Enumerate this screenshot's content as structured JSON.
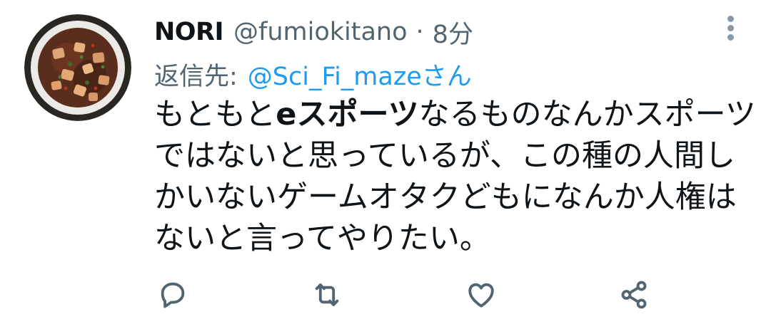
{
  "tweet": {
    "author": {
      "display_name": "NORI",
      "handle": "@fumiokitano"
    },
    "separator": "·",
    "timestamp": "8分",
    "reply": {
      "label": "返信先:",
      "target": "@Sci_Fi_mazeさん"
    },
    "body": {
      "line1_pre": "もともと",
      "line1_bold": "eスポーツ",
      "line1_post": "なるものなんかスポーツ",
      "line2": "ではないと思っているが、この種の人間し",
      "line3": "かいないゲームオタクどもになんか人権は",
      "line4": "ないと言ってやりたい。"
    }
  },
  "icons": {
    "more": "more-vertical-icon",
    "reply": "comment-icon",
    "retweet": "retweet-icon",
    "like": "heart-icon",
    "share": "share-icon"
  },
  "colors": {
    "link": "#1d9bf0",
    "secondary_text": "#536471",
    "primary_text": "#0f1419"
  }
}
